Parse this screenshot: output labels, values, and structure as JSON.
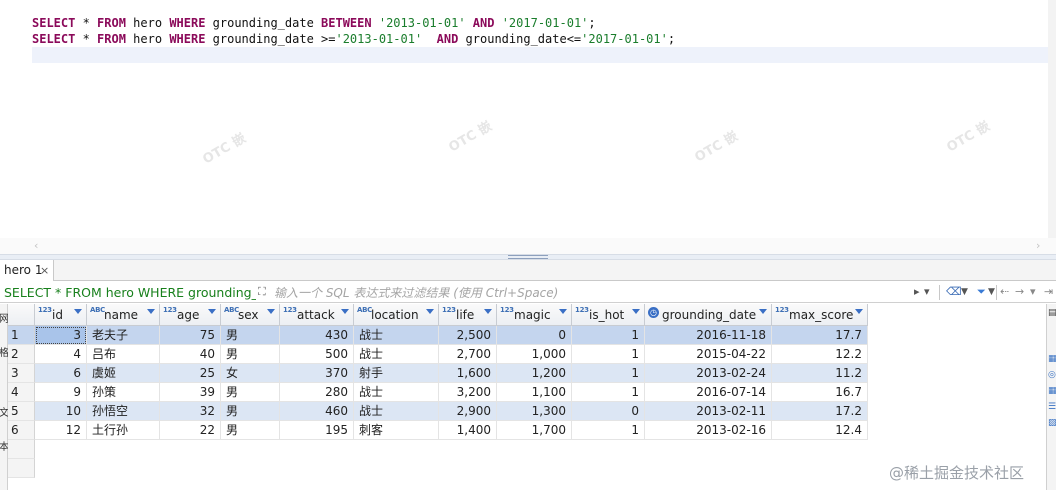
{
  "editor": {
    "line1": [
      {
        "t": "SELECT",
        "c": "kw"
      },
      {
        "t": " * ",
        "c": "plain"
      },
      {
        "t": "FROM",
        "c": "kw"
      },
      {
        "t": " hero ",
        "c": "plain"
      },
      {
        "t": "WHERE",
        "c": "kw"
      },
      {
        "t": " grounding_date ",
        "c": "plain"
      },
      {
        "t": "BETWEEN",
        "c": "kw"
      },
      {
        "t": " ",
        "c": "plain"
      },
      {
        "t": "'2013-01-01'",
        "c": "str"
      },
      {
        "t": " ",
        "c": "plain"
      },
      {
        "t": "AND",
        "c": "kw"
      },
      {
        "t": " ",
        "c": "plain"
      },
      {
        "t": "'2017-01-01'",
        "c": "str"
      },
      {
        "t": ";",
        "c": "plain"
      }
    ],
    "line2": [
      {
        "t": "SELECT",
        "c": "kw"
      },
      {
        "t": " * ",
        "c": "plain"
      },
      {
        "t": "FROM",
        "c": "kw"
      },
      {
        "t": " hero ",
        "c": "plain"
      },
      {
        "t": "WHERE",
        "c": "kw"
      },
      {
        "t": " grounding_date >=",
        "c": "plain"
      },
      {
        "t": "'2013-01-01'",
        "c": "str"
      },
      {
        "t": "  ",
        "c": "plain"
      },
      {
        "t": "AND",
        "c": "kw"
      },
      {
        "t": " grounding_date<=",
        "c": "plain"
      },
      {
        "t": "'2017-01-01'",
        "c": "str"
      },
      {
        "t": ";",
        "c": "plain"
      }
    ]
  },
  "watermark_text": "OTC 嵌",
  "result_tab": {
    "label": "hero 1",
    "close": "×"
  },
  "filter": {
    "query": "SELECT * FROM hero WHERE grounding_dat",
    "placeholder": "输入一个 SQL 表达式来过滤结果 (使用 Ctrl+Space)"
  },
  "left_panel_chars": [
    "网",
    "格",
    "文",
    "本"
  ],
  "columns": [
    {
      "name": "id",
      "type": "123",
      "w": 52
    },
    {
      "name": "name",
      "type": "ABC",
      "w": 73
    },
    {
      "name": "age",
      "type": "123",
      "w": 61
    },
    {
      "name": "sex",
      "type": "ABC",
      "w": 59
    },
    {
      "name": "attack",
      "type": "123",
      "w": 74
    },
    {
      "name": "location",
      "type": "ABC",
      "w": 85
    },
    {
      "name": "life",
      "type": "123",
      "w": 58
    },
    {
      "name": "magic",
      "type": "123",
      "w": 75
    },
    {
      "name": "is_hot",
      "type": "123",
      "w": 73
    },
    {
      "name": "grounding_date",
      "type": "date",
      "w": 127
    },
    {
      "name": "max_score",
      "type": "123",
      "w": 96
    }
  ],
  "rows": [
    {
      "n": "1",
      "cells": [
        "3",
        "老夫子",
        "75",
        "男",
        "430",
        "战士",
        "2,500",
        "0",
        "1",
        "2016-11-18",
        "17.7"
      ]
    },
    {
      "n": "2",
      "cells": [
        "4",
        "吕布",
        "40",
        "男",
        "500",
        "战士",
        "2,700",
        "1,000",
        "1",
        "2015-04-22",
        "12.2"
      ]
    },
    {
      "n": "3",
      "cells": [
        "6",
        "虞姬",
        "25",
        "女",
        "370",
        "射手",
        "1,600",
        "1,200",
        "1",
        "2013-02-24",
        "11.2"
      ]
    },
    {
      "n": "4",
      "cells": [
        "9",
        "孙策",
        "39",
        "男",
        "280",
        "战士",
        "3,200",
        "1,100",
        "1",
        "2016-07-14",
        "16.7"
      ]
    },
    {
      "n": "5",
      "cells": [
        "10",
        "孙悟空",
        "32",
        "男",
        "460",
        "战士",
        "2,900",
        "1,300",
        "0",
        "2013-02-11",
        "17.2"
      ]
    },
    {
      "n": "6",
      "cells": [
        "12",
        "土行孙",
        "22",
        "男",
        "195",
        "刺客",
        "1,400",
        "1,700",
        "1",
        "2013-02-16",
        "12.4"
      ]
    }
  ],
  "numeric_columns": [
    0,
    2,
    4,
    6,
    7,
    8,
    9,
    10
  ],
  "selected_row_index": 0,
  "alt_rows": [
    2,
    4
  ],
  "footer_watermark": "@稀土掘金技术社区"
}
